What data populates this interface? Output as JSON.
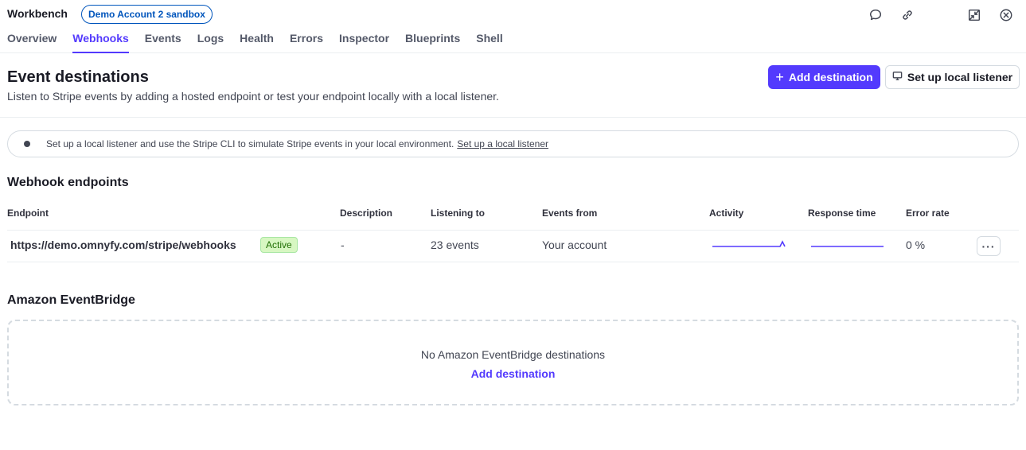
{
  "header": {
    "app_title": "Workbench",
    "sandbox_badge": "Demo Account 2 sandbox",
    "icons": [
      "feedback-icon",
      "link-icon",
      "collapse-icon",
      "close-icon"
    ]
  },
  "tabs": [
    {
      "label": "Overview"
    },
    {
      "label": "Webhooks",
      "active": true
    },
    {
      "label": "Events"
    },
    {
      "label": "Logs"
    },
    {
      "label": "Health"
    },
    {
      "label": "Errors"
    },
    {
      "label": "Inspector"
    },
    {
      "label": "Blueprints"
    },
    {
      "label": "Shell"
    }
  ],
  "page": {
    "title": "Event destinations",
    "subtitle": "Listen to Stripe events by adding a hosted endpoint or test your endpoint locally with a local listener.",
    "add_destination_label": "Add destination",
    "local_listener_label": "Set up local listener"
  },
  "banner": {
    "text": "Set up a local listener and use the Stripe CLI to simulate Stripe events in your local environment.",
    "link": "Set up a local listener"
  },
  "webhooks": {
    "title": "Webhook endpoints",
    "columns": [
      "Endpoint",
      "Description",
      "Listening to",
      "Events from",
      "Activity",
      "Response time",
      "Error rate"
    ],
    "rows": [
      {
        "endpoint": "https://demo.omnyfy.com/stripe/webhooks",
        "status": "Active",
        "description": "-",
        "listening_to": "23 events",
        "events_from": "Your account",
        "error_rate": "0 %"
      }
    ]
  },
  "eventbridge": {
    "title": "Amazon EventBridge",
    "empty_text": "No Amazon EventBridge destinations",
    "add_label": "Add destination"
  },
  "colors": {
    "accent": "#533afd",
    "badge_text": "#0055bc",
    "status_active_bg": "#d7f7c2",
    "status_active_text": "#217005"
  }
}
